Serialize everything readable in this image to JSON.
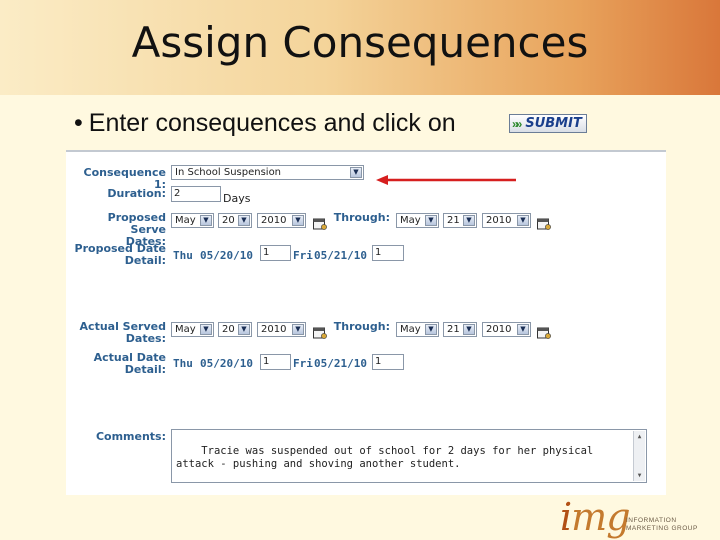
{
  "slide": {
    "title": "Assign Consequences",
    "bullet": "Enter consequences and click on",
    "bullet_mark": "•",
    "submit_label": "SUBMIT"
  },
  "form": {
    "consequence_label": "Consequence 1:",
    "consequence_value": "In School Suspension",
    "duration_label": "Duration:",
    "duration_value": "2",
    "duration_unit": "Days",
    "proposed_dates_label_1": "Proposed Serve",
    "proposed_dates_label_2": "Dates:",
    "proposed_start": {
      "month": "May",
      "day": "20",
      "year": "2010"
    },
    "proposed_through_label": "Through:",
    "proposed_end": {
      "month": "May",
      "day": "21",
      "year": "2010"
    },
    "proposed_detail_label_1": "Proposed Date",
    "proposed_detail_label_2": "Detail:",
    "proposed_detail": [
      {
        "day_name": "Thu",
        "date": "05/20/10",
        "value": "1"
      },
      {
        "day_name": "Fri",
        "date": "05/21/10",
        "value": "1"
      }
    ],
    "actual_dates_label_1": "Actual Served",
    "actual_dates_label_2": "Dates:",
    "actual_start": {
      "month": "May",
      "day": "20",
      "year": "2010"
    },
    "actual_through_label": "Through:",
    "actual_end": {
      "month": "May",
      "day": "21",
      "year": "2010"
    },
    "actual_detail_label_1": "Actual Date",
    "actual_detail_label_2": "Detail:",
    "actual_detail": [
      {
        "day_name": "Thu",
        "date": "05/20/10",
        "value": "1"
      },
      {
        "day_name": "Fri",
        "date": "05/21/10",
        "value": "1"
      }
    ],
    "comments_label": "Comments:",
    "comments_value": "Tracie was suspended out of school for 2 days for her physical\nattack - pushing and shoving another student."
  },
  "logo": {
    "mark_i": "i",
    "mark_rest": "mg",
    "line1": "INFORMATION",
    "line2": "MARKETING GROUP"
  },
  "icons": [
    "submit-arrow-icon",
    "calendar-icon",
    "red-arrow-icon",
    "dropdown-arrow-icon"
  ],
  "colors": {
    "label_blue": "#2d5f8f",
    "arrow_red": "#d61f1f",
    "brand_orange": "#c47a2e"
  }
}
